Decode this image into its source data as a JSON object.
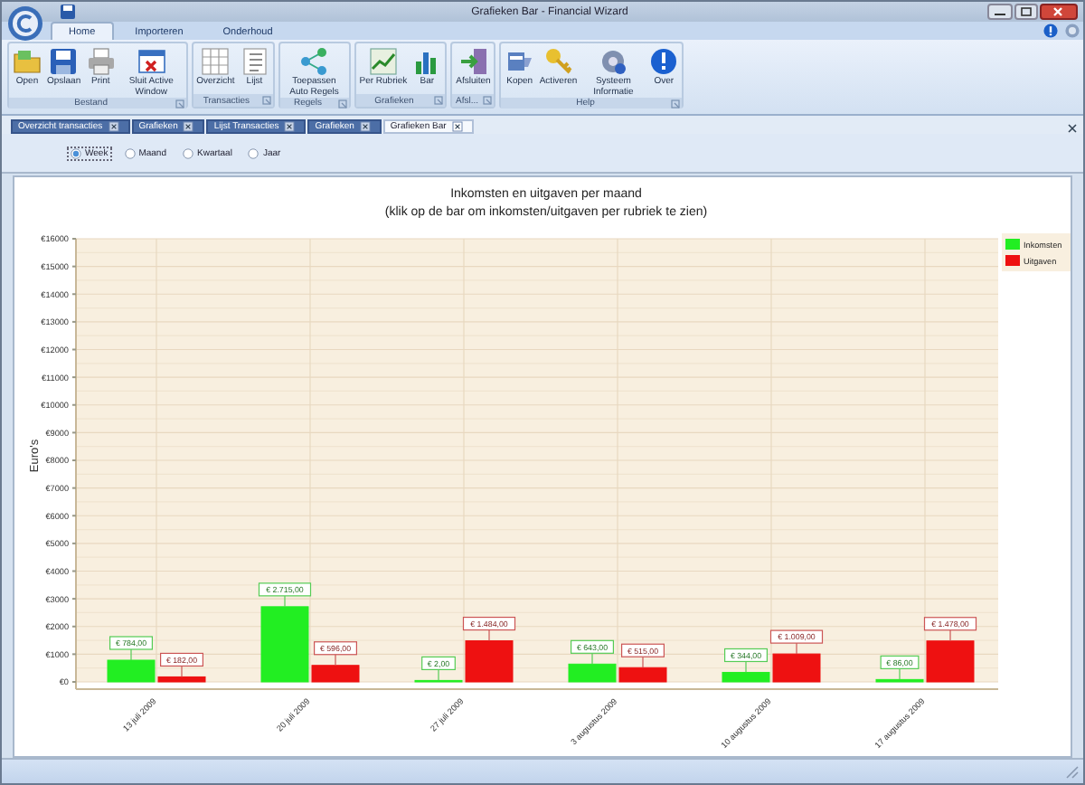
{
  "window": {
    "title": "Grafieken Bar - Financial Wizard"
  },
  "ribbon_tabs": [
    {
      "label": "Home",
      "selected": true
    },
    {
      "label": "Importeren",
      "selected": false
    },
    {
      "label": "Onderhoud",
      "selected": false
    }
  ],
  "ribbon_groups": [
    {
      "label": "Bestand",
      "buttons": [
        {
          "label": "Open"
        },
        {
          "label": "Opslaan"
        },
        {
          "label": "Print"
        },
        {
          "label": "Sluit Active Window"
        }
      ]
    },
    {
      "label": "Transacties",
      "buttons": [
        {
          "label": "Overzicht"
        },
        {
          "label": "Lijst"
        }
      ]
    },
    {
      "label": "Regels",
      "buttons": [
        {
          "label": "Toepassen Auto Regels"
        }
      ]
    },
    {
      "label": "Grafieken",
      "buttons": [
        {
          "label": "Per Rubriek"
        },
        {
          "label": "Bar"
        }
      ]
    },
    {
      "label": "Afsl...",
      "buttons": [
        {
          "label": "Afsluiten"
        }
      ]
    },
    {
      "label": "Help",
      "buttons": [
        {
          "label": "Kopen"
        },
        {
          "label": "Activeren"
        },
        {
          "label": "Systeem Informatie"
        },
        {
          "label": "Over"
        }
      ]
    }
  ],
  "document_tabs": [
    {
      "label": "Overzicht transacties",
      "selected": false
    },
    {
      "label": "Grafieken",
      "selected": false
    },
    {
      "label": "Lijst Transacties",
      "selected": false
    },
    {
      "label": "Grafieken",
      "selected": false
    },
    {
      "label": "Grafieken Bar",
      "selected": true
    }
  ],
  "period_options": [
    {
      "label": "Week",
      "selected": true
    },
    {
      "label": "Maand",
      "selected": false
    },
    {
      "label": "Kwartaal",
      "selected": false
    },
    {
      "label": "Jaar",
      "selected": false
    }
  ],
  "chart": {
    "subtitle": "(klik op de bar om inkomsten/uitgaven per rubriek te zien)",
    "chart_data": {
      "type": "bar",
      "title": "Inkomsten en uitgaven per maand",
      "ylabel": "Euro's",
      "categories": [
        "13 juli 2009",
        "20 juli 2009",
        "27 juli 2009",
        "3 augustus 2009",
        "10 augustus 2009",
        "17 augustus 2009"
      ],
      "series": [
        {
          "name": "Inkomsten",
          "color": "#22ee22",
          "values": [
            784,
            2715,
            2,
            643,
            344,
            86
          ],
          "value_labels": [
            "€ 784,00",
            "€ 2.715,00",
            "€ 2,00",
            "€ 643,00",
            "€ 344,00",
            "€ 86,00"
          ]
        },
        {
          "name": "Uitgaven",
          "color": "#ee1111",
          "values": [
            182,
            596,
            1484,
            515,
            1009,
            1478
          ],
          "value_labels": [
            "€ 182,00",
            "€ 596,00",
            "€ 1.484,00",
            "€ 515,00",
            "€ 1.009,00",
            "€ 1.478,00"
          ]
        }
      ],
      "ylim": [
        0,
        16000
      ],
      "yticks": [
        {
          "value": 0,
          "label": "€0"
        },
        {
          "value": 1000,
          "label": "€1000"
        },
        {
          "value": 2000,
          "label": "€2000"
        },
        {
          "value": 3000,
          "label": "€3000"
        },
        {
          "value": 4000,
          "label": "€4000"
        },
        {
          "value": 5000,
          "label": "€5000"
        },
        {
          "value": 6000,
          "label": "€6000"
        },
        {
          "value": 7000,
          "label": "€7000"
        },
        {
          "value": 8000,
          "label": "€8000"
        },
        {
          "value": 9000,
          "label": "€9000"
        },
        {
          "value": 10000,
          "label": "€10000"
        },
        {
          "value": 11000,
          "label": "€11000"
        },
        {
          "value": 12000,
          "label": "€12000"
        },
        {
          "value": 13000,
          "label": "€13000"
        },
        {
          "value": 14000,
          "label": "€14000"
        },
        {
          "value": 15000,
          "label": "€15000"
        },
        {
          "value": 16000,
          "label": "€16000"
        }
      ],
      "data_labels": true,
      "grid": true,
      "legend": true
    }
  }
}
